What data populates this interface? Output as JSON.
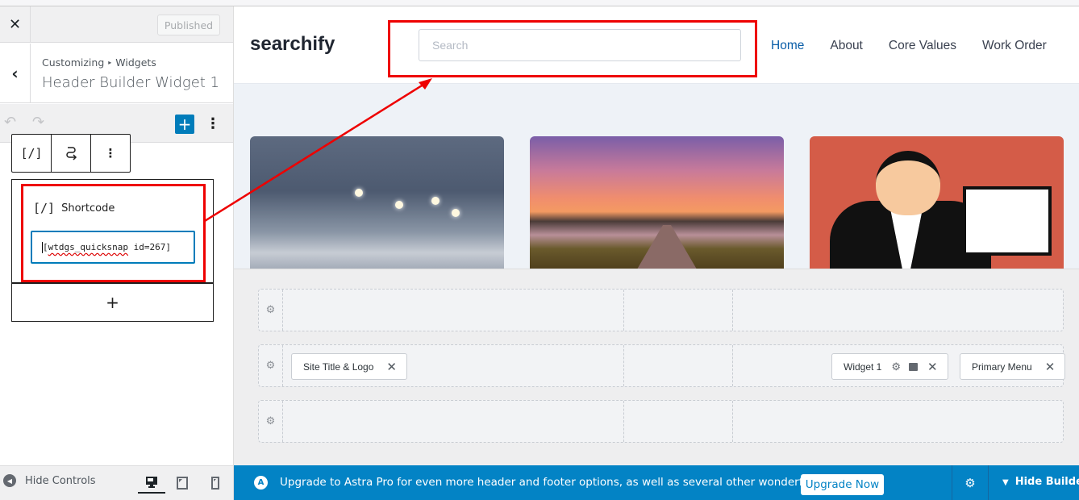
{
  "panel": {
    "close_label": "✕",
    "publish_label": "Published",
    "back_label": "‹",
    "breadcrumb": [
      "Customizing",
      "Widgets"
    ],
    "breadcrumb_sep": "▸",
    "section_title": "Header Builder Widget 1",
    "toolbar": {
      "undo": "↶",
      "redo": "↷",
      "add": "+",
      "more": "⋮"
    },
    "block_toolbar": {
      "type_icon": "[/]",
      "transform_icon": "⤻",
      "options_icon": "⋮"
    },
    "shortcode_block": {
      "icon": "[/]",
      "label": "Shortcode",
      "value_prefix": "[",
      "value_typo": "wtdgs_quicksnap",
      "value_rest": " id=267]"
    },
    "add_block_label": "+",
    "footer": {
      "hide_controls": "Hide Controls",
      "devices": [
        "desktop",
        "tablet",
        "mobile"
      ],
      "active_device": "desktop"
    }
  },
  "preview": {
    "site_title": "searchify",
    "search_placeholder": "Search",
    "nav": [
      {
        "label": "Home",
        "active": true
      },
      {
        "label": "About",
        "active": false
      },
      {
        "label": "Core Values",
        "active": false
      },
      {
        "label": "Work Order",
        "active": false
      }
    ],
    "cards": [
      {
        "subject": "snowy city street with pedestrians"
      },
      {
        "subject": "misty country road at sunset"
      },
      {
        "subject": "illustrated businesswoman holding blank board"
      }
    ]
  },
  "builder": {
    "rows": [
      {
        "chips_left": [],
        "chips_right": []
      },
      {
        "chips_left": [
          {
            "label": "Site Title & Logo"
          }
        ],
        "chips_right": [
          {
            "label": "Widget 1"
          },
          {
            "label": "Primary Menu"
          }
        ]
      },
      {
        "chips_left": [],
        "chips_right": []
      }
    ],
    "remove_icon": "✕",
    "gear_icon": "⚙"
  },
  "upgrade_bar": {
    "logo": "A",
    "message": "Upgrade to Astra Pro for even more header and footer options, as well as several other wonderful features!",
    "cta": "Upgrade Now",
    "hide_builder": "Hide Builder",
    "chevron": "▼",
    "bar_color": "#0383c5"
  },
  "annotation_color": "#ee0000"
}
